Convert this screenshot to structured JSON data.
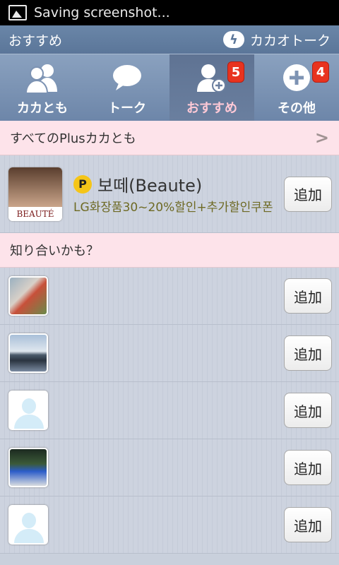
{
  "status_bar": {
    "text": "Saving screenshot..."
  },
  "title_bar": {
    "title": "おすすめ",
    "brand": "カカオトーク"
  },
  "tabs": [
    {
      "label": "カカとも",
      "icon": "friends-icon",
      "badge": null
    },
    {
      "label": "トーク",
      "icon": "chat-bubble-icon",
      "badge": null
    },
    {
      "label": "おすすめ",
      "icon": "add-friend-icon",
      "badge": "5"
    },
    {
      "label": "その他",
      "icon": "plus-circle-icon",
      "badge": "4"
    }
  ],
  "plus_section": {
    "label": "すべてのPlusカカとも"
  },
  "plus_friend": {
    "badge": "P",
    "name": "보떼(Beaute)",
    "description": "LG화장품30~20%할인+추가할인쿠폰",
    "logo_text": "BEAUTÉ",
    "add_label": "追加"
  },
  "suggest_section": {
    "label": "知り合いかも？"
  },
  "suggestions": [
    {
      "add_label": "追加"
    },
    {
      "add_label": "追加"
    },
    {
      "add_label": "追加"
    },
    {
      "add_label": "追加"
    },
    {
      "add_label": "追加"
    }
  ]
}
